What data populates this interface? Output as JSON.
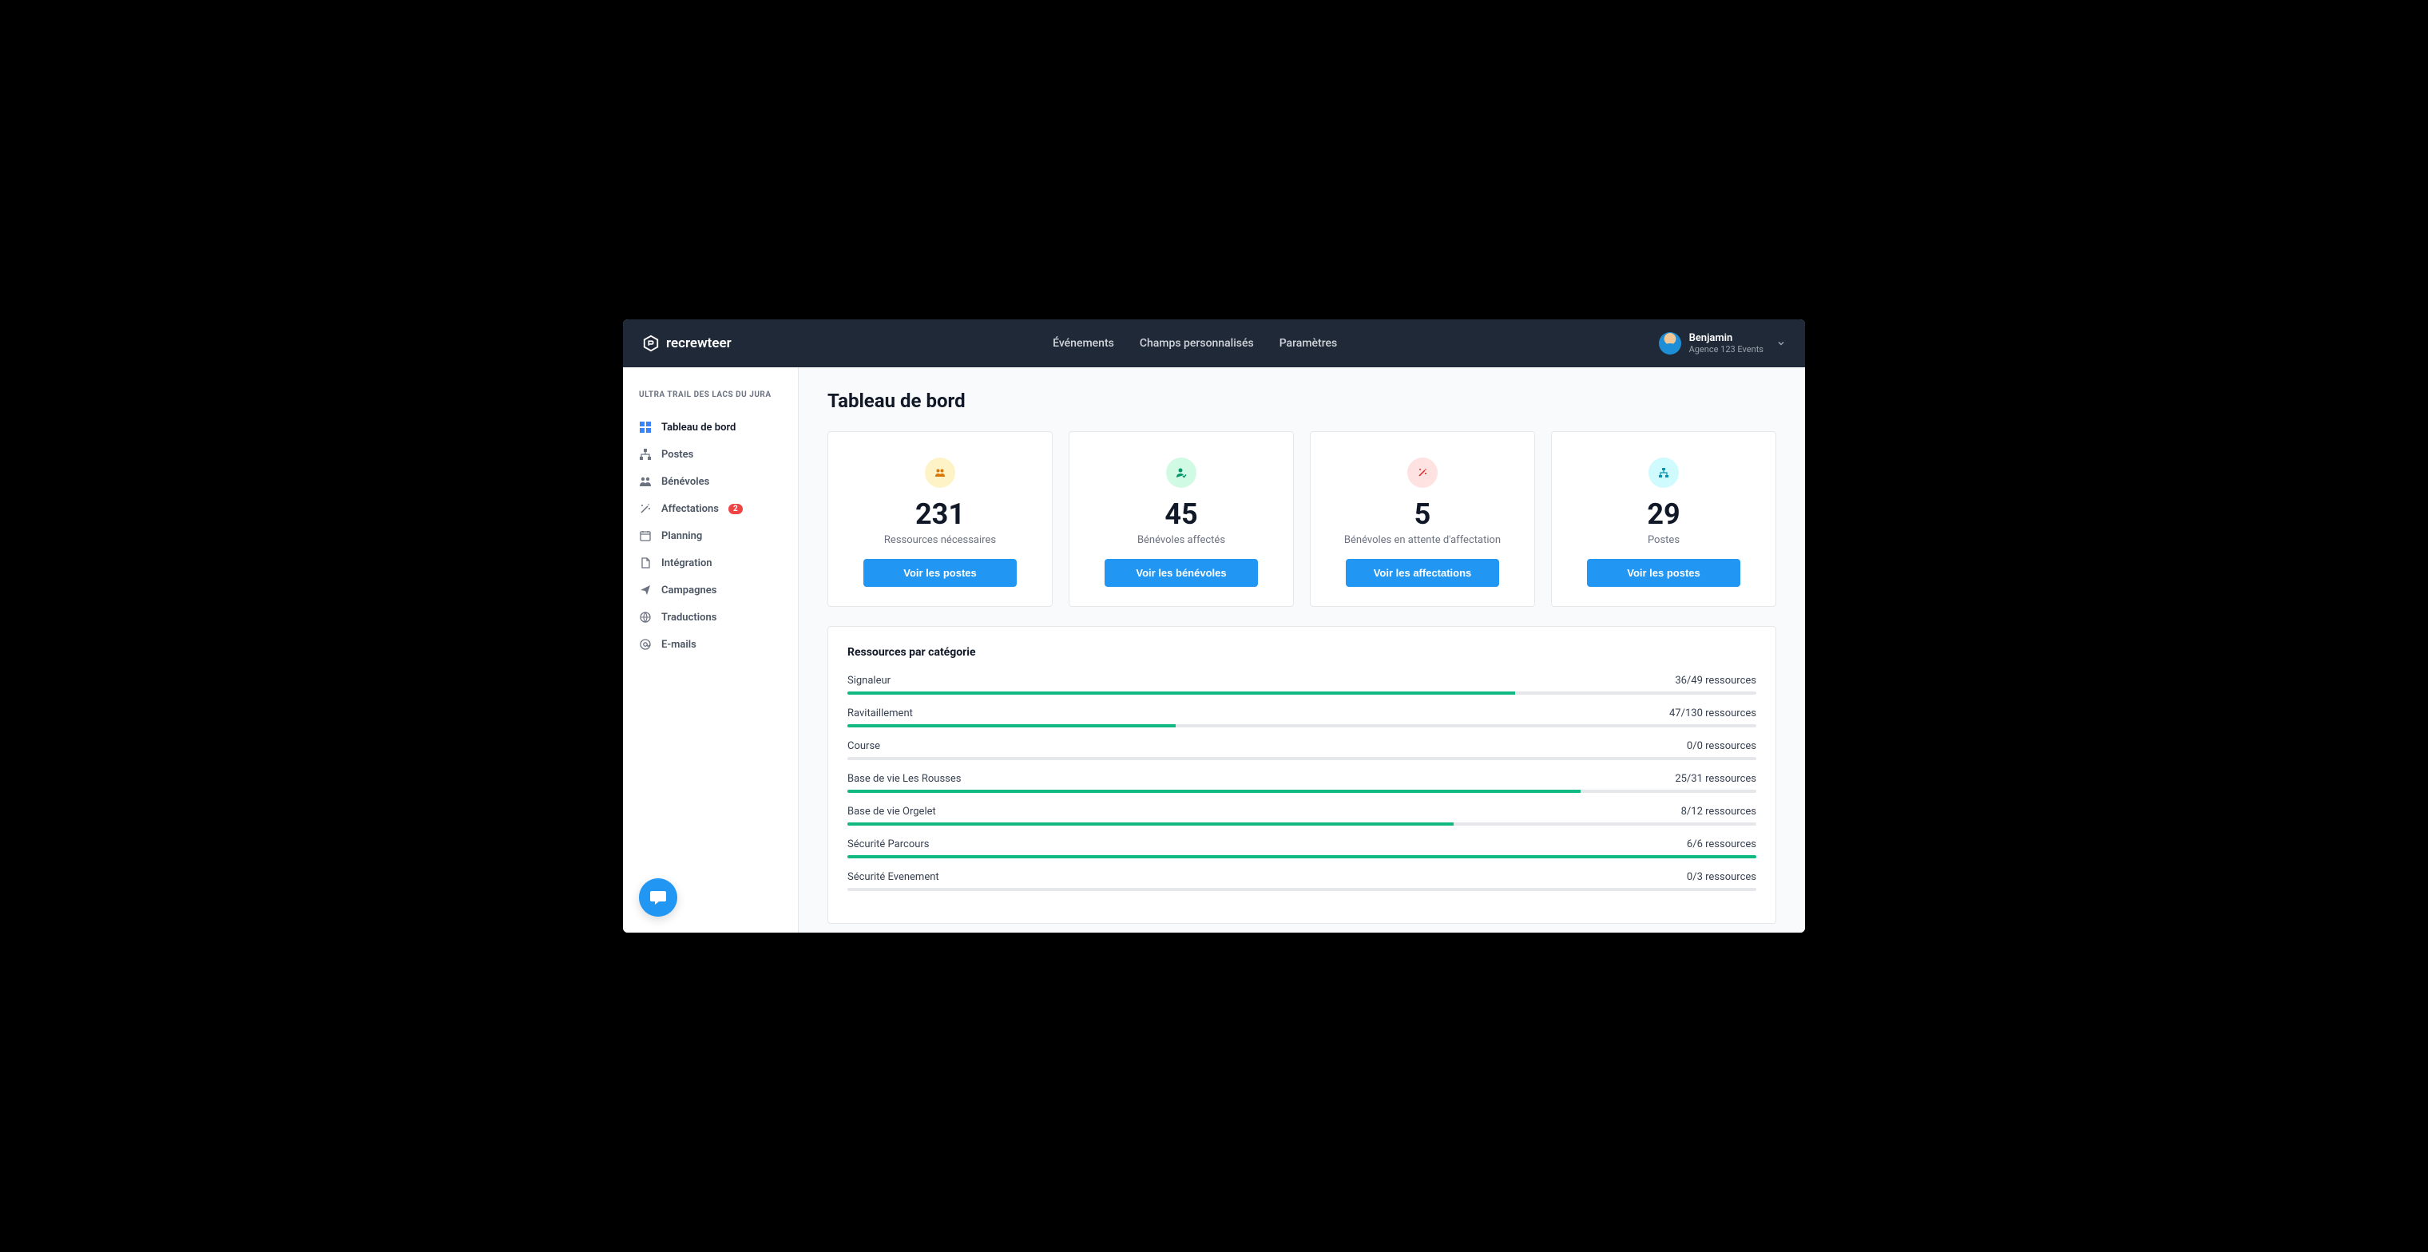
{
  "brand": "recrewteer",
  "topnav": {
    "events": "Événements",
    "custom_fields": "Champs personnalisés",
    "settings": "Paramètres"
  },
  "user": {
    "name": "Benjamin",
    "org": "Agence 123 Events"
  },
  "sidebar": {
    "event_name": "ULTRA TRAIL DES LACS DU JURA",
    "items": [
      {
        "label": "Tableau de bord"
      },
      {
        "label": "Postes"
      },
      {
        "label": "Bénévoles"
      },
      {
        "label": "Affectations",
        "badge": "2"
      },
      {
        "label": "Planning"
      },
      {
        "label": "Intégration"
      },
      {
        "label": "Campagnes"
      },
      {
        "label": "Traductions"
      },
      {
        "label": "E-mails"
      }
    ]
  },
  "page": {
    "title": "Tableau de bord"
  },
  "cards": [
    {
      "value": "231",
      "label": "Ressources nécessaires",
      "button": "Voir les postes",
      "color": "yellow"
    },
    {
      "value": "45",
      "label": "Bénévoles affectés",
      "button": "Voir les bénévoles",
      "color": "green"
    },
    {
      "value": "5",
      "label": "Bénévoles en attente d'affectation",
      "button": "Voir les affectations",
      "color": "red"
    },
    {
      "value": "29",
      "label": "Postes",
      "button": "Voir les postes",
      "color": "blue"
    }
  ],
  "resources_panel": {
    "title": "Ressources par catégorie",
    "suffix": " ressources",
    "categories": [
      {
        "name": "Signaleur",
        "filled": 36,
        "total": 49
      },
      {
        "name": "Ravitaillement",
        "filled": 47,
        "total": 130
      },
      {
        "name": "Course",
        "filled": 0,
        "total": 0
      },
      {
        "name": "Base de vie Les Rousses",
        "filled": 25,
        "total": 31
      },
      {
        "name": "Base de vie Orgelet",
        "filled": 8,
        "total": 12
      },
      {
        "name": "Sécurité Parcours",
        "filled": 6,
        "total": 6
      },
      {
        "name": "Sécurité Evenement",
        "filled": 0,
        "total": 3
      }
    ]
  }
}
